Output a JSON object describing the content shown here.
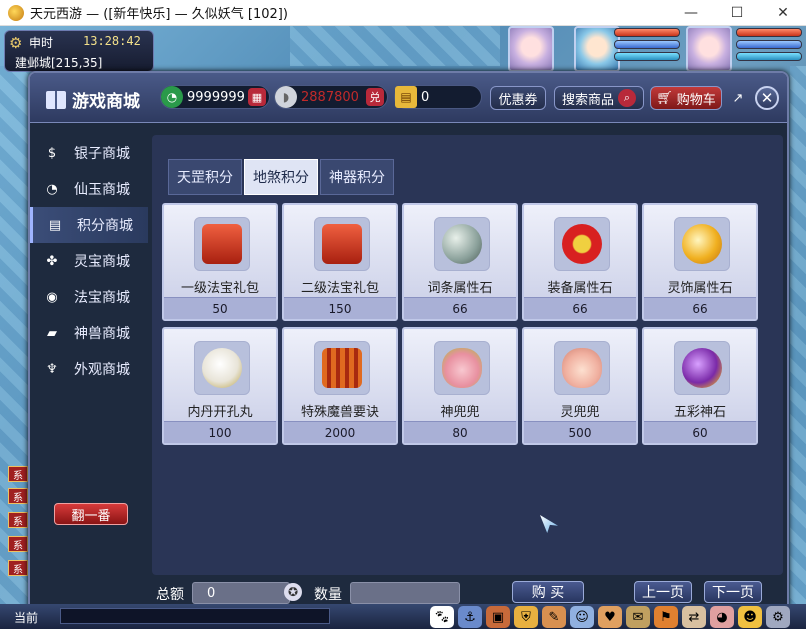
{
  "window": {
    "title": "天元西游 — ([新年快乐] — 久似妖气 [102])",
    "min": "—",
    "max": "☐",
    "close": "✕"
  },
  "hud": {
    "shichen": "申时",
    "clock": "13:28:42",
    "location": "建邺城[215,35]"
  },
  "shop": {
    "title": "游戏商城",
    "currency_jade": "9999999",
    "currency_silver": "2887800",
    "currency_ticket": "0",
    "exchange_label": "兑",
    "promo_button": "优惠券",
    "search_button": "搜索商品",
    "cart_button": "购物车",
    "close": "✕",
    "colors": {
      "accent": "#6e7ca8",
      "red": "#b8293a",
      "silver_text": "#c02a2a"
    }
  },
  "sidebar": {
    "items": [
      {
        "label": "银子商城",
        "icon": "money-bag-icon",
        "glyph": "$"
      },
      {
        "label": "仙玉商城",
        "icon": "jade-icon",
        "glyph": "◔"
      },
      {
        "label": "积分商城",
        "icon": "gift-box-icon",
        "glyph": "▤"
      },
      {
        "label": "灵宝商城",
        "icon": "clover-icon",
        "glyph": "✤"
      },
      {
        "label": "法宝商城",
        "icon": "orb-icon",
        "glyph": "◉"
      },
      {
        "label": "神兽商城",
        "icon": "beast-icon",
        "glyph": "▰"
      },
      {
        "label": "外观商城",
        "icon": "clothes-icon",
        "glyph": "♆"
      }
    ],
    "active_index": 2,
    "flip_button": "翻一番"
  },
  "tabs": [
    "天罡积分",
    "地煞积分",
    "神器积分"
  ],
  "active_tab": 1,
  "items": [
    {
      "name": "一级法宝礼包",
      "price": "50",
      "icon": "red-gift-box-icon",
      "color": "#d8402a"
    },
    {
      "name": "二级法宝礼包",
      "price": "150",
      "icon": "red-gift-box-icon",
      "color": "#d8402a"
    },
    {
      "name": "词条属性石",
      "price": "66",
      "icon": "pearl-stone-icon",
      "color": "#8aa09a"
    },
    {
      "name": "装备属性石",
      "price": "66",
      "icon": "red-medal-icon",
      "color": "#d82020"
    },
    {
      "name": "灵饰属性石",
      "price": "66",
      "icon": "gold-orb-icon",
      "color": "#f0b020"
    },
    {
      "name": "内丹开孔丸",
      "price": "100",
      "icon": "white-pill-icon",
      "color": "#eeeeee"
    },
    {
      "name": "特殊魔兽要诀",
      "price": "2000",
      "icon": "red-book-icon",
      "color": "#c8401a"
    },
    {
      "name": "神兜兜",
      "price": "80",
      "icon": "pouch-icon",
      "color": "#e890a0"
    },
    {
      "name": "灵兜兜",
      "price": "500",
      "icon": "pink-pouch-icon",
      "color": "#f0b0a0"
    },
    {
      "name": "五彩神石",
      "price": "60",
      "icon": "purple-gem-icon",
      "color": "#7a2aa8"
    }
  ],
  "footer": {
    "total_label": "总额",
    "total_value": "0",
    "qty_label": "数量",
    "qty_value": "",
    "buy_button": "购 买",
    "prev_button": "上一页",
    "next_button": "下一页"
  },
  "chat": {
    "tag": "系",
    "input_label": "当前"
  }
}
